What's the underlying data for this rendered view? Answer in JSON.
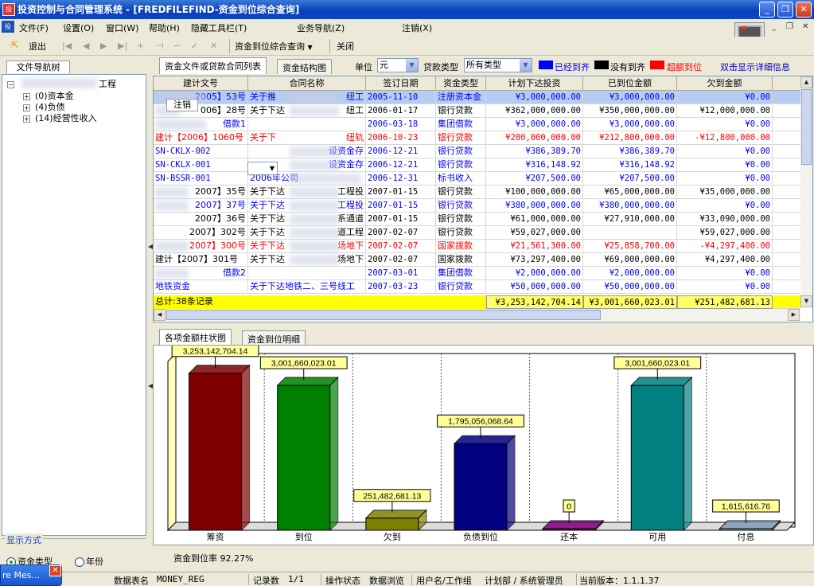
{
  "window": {
    "title": "投资控制与合同管理系统 - [FREDFILEFIND-资金到位综合查询]"
  },
  "menu": [
    "文件(F)",
    "设置(O)",
    "窗口(W)",
    "帮助(H)",
    "隐藏工具栏(T)",
    "业务导航(Z)",
    "注销(X)"
  ],
  "toolbar": {
    "exit": "退出",
    "query": "资金到位综合查询",
    "close": "关闭"
  },
  "left": {
    "tab": "文件导航树",
    "tab2": "",
    "tree": [
      {
        "label": "工程",
        "sign": "−"
      },
      {
        "label": "(0)资本金",
        "sign": "+"
      },
      {
        "label": "(4)负债",
        "sign": "+"
      },
      {
        "label": "(14)经营性收入",
        "sign": "+"
      }
    ],
    "display_title": "显示方式",
    "radio1": "资金类型",
    "radio2": "年份"
  },
  "top_tabs": [
    "资金文件或贷款合同列表",
    "资金结构图"
  ],
  "filters": {
    "unit_label": "单位",
    "unit_value": "元",
    "loan_label": "贷款类型",
    "loan_value": "所有类型"
  },
  "legend": [
    {
      "label": "已经到齐",
      "color": "#0000ff"
    },
    {
      "label": "没有到齐",
      "color": "#000000"
    },
    {
      "label": "超额到位",
      "color": "#ff0000"
    },
    {
      "label": "双击显示详细信息",
      "color": ""
    }
  ],
  "grid": {
    "columns": [
      "建计文号",
      "合同名称",
      "签订日期",
      "资金类型",
      "计划下达投资",
      "已到位金额",
      "欠到金额"
    ],
    "rows": [
      {
        "doc": "2005】53号",
        "name": "关于推",
        "name2": "纽工",
        "date": "2005-11-10",
        "type": "注册资本金",
        "plan": "¥3,000,000.00",
        "arrived": "¥3,000,000.00",
        "owed": "¥0.00",
        "status": "selected"
      },
      {
        "doc": "006】28号",
        "name": "关于下达",
        "name2": "纽工",
        "date": "2006-01-17",
        "type": "银行贷款",
        "plan": "¥362,000,000.00",
        "arrived": "¥350,000,000.00",
        "owed": "¥12,000,000.00",
        "status": "short"
      },
      {
        "doc": "借款1",
        "name": "",
        "name2": "",
        "date": "2006-03-18",
        "type": "集团借款",
        "plan": "¥3,000,000.00",
        "arrived": "¥3,000,000.00",
        "owed": "¥0.00",
        "status": "full"
      },
      {
        "doc": "建计【2006】1060号",
        "name": "关于下",
        "name2": "纽轨",
        "date": "2006-10-23",
        "type": "银行贷款",
        "plan": "¥200,000,000.00",
        "arrived": "¥212,800,000.00",
        "owed": "-¥12,800,000.00",
        "status": "over"
      },
      {
        "doc": "SN-CKLX-002",
        "name": "",
        "name2": "设资金存",
        "date": "2006-12-21",
        "type": "银行贷款",
        "plan": "¥386,389.70",
        "arrived": "¥386,389.70",
        "owed": "¥0.00",
        "status": "full"
      },
      {
        "doc": "SN-CKLX-001",
        "name": "",
        "name2": "设资金存",
        "date": "2006-12-21",
        "type": "银行贷款",
        "plan": "¥316,148.92",
        "arrived": "¥316,148.92",
        "owed": "¥0.00",
        "status": "full"
      },
      {
        "doc": "SN-BSSR-001",
        "name": "2006年公司",
        "name2": "",
        "date": "2006-12-31",
        "type": "标书收入",
        "plan": "¥207,500.00",
        "arrived": "¥207,500.00",
        "owed": "¥0.00",
        "status": "full"
      },
      {
        "doc": "2007】35号",
        "name": "关于下达",
        "name2": "工程投",
        "date": "2007-01-15",
        "type": "银行贷款",
        "plan": "¥100,000,000.00",
        "arrived": "¥65,000,000.00",
        "owed": "¥35,000,000.00",
        "status": "short"
      },
      {
        "doc": "2007】37号",
        "name": "关于下达",
        "name2": "工程投",
        "date": "2007-01-15",
        "type": "银行贷款",
        "plan": "¥380,000,000.00",
        "arrived": "¥380,000,000.00",
        "owed": "¥0.00",
        "status": "full"
      },
      {
        "doc": "2007】36号",
        "name": "关于下达",
        "name2": "系通道",
        "date": "2007-01-15",
        "type": "银行贷款",
        "plan": "¥61,000,000.00",
        "arrived": "¥27,910,000.00",
        "owed": "¥33,090,000.00",
        "status": "short"
      },
      {
        "doc": "2007】302号",
        "name": "关于下达",
        "name2": "道工程",
        "date": "2007-02-07",
        "type": "银行贷款",
        "plan": "¥59,027,000.00",
        "arrived": "",
        "owed": "¥59,027,000.00",
        "status": "short"
      },
      {
        "doc": "2007】300号",
        "name": "关于下达",
        "name2": "场地下",
        "date": "2007-02-07",
        "type": "国家拨款",
        "plan": "¥21,561,300.00",
        "arrived": "¥25,858,700.00",
        "owed": "-¥4,297,400.00",
        "status": "over"
      },
      {
        "doc": "建计【2007】301号",
        "name": "关于下达",
        "name2": "场地下",
        "date": "2007-02-07",
        "type": "国家拨款",
        "plan": "¥73,297,400.00",
        "arrived": "¥69,000,000.00",
        "owed": "¥4,297,400.00",
        "status": "short"
      },
      {
        "doc": "借款2",
        "name": "",
        "name2": "",
        "date": "2007-03-01",
        "type": "集团借款",
        "plan": "¥2,000,000.00",
        "arrived": "¥2,000,000.00",
        "owed": "¥0.00",
        "status": "full"
      },
      {
        "doc": "地铁资金",
        "name": "关于下达地铁二、三号线工",
        "name2": "",
        "date": "2007-03-23",
        "type": "银行贷款",
        "plan": "¥50,000,000.00",
        "arrived": "¥50,000,000.00",
        "owed": "¥0.00",
        "status": "full"
      }
    ],
    "popup_text": "注销",
    "summary": {
      "label": "总计:38条记录",
      "plan": "¥3,253,142,704.14",
      "arrived": "¥3,001,660,023.01",
      "owed": "¥251,482,681.13"
    }
  },
  "chart_tabs": [
    "各项金额柱状图",
    "资金到位明细"
  ],
  "chart_data": {
    "type": "bar",
    "categories": [
      "筹资",
      "到位",
      "欠到",
      "负债到位",
      "还本",
      "可用",
      "付息"
    ],
    "values": [
      3253142704.14,
      3001660023.01,
      251482681.13,
      1795056068.64,
      0,
      3001660023.01,
      1615616.76
    ],
    "labels": [
      "3,253,142,704.14",
      "3,001,660,023.01",
      "251,482,681.13",
      "1,795,056,068.64",
      "0",
      "3,001,660,023.01",
      "1,615,616.76"
    ],
    "colors": [
      "#800000",
      "#008000",
      "#808000",
      "#000080",
      "#800080",
      "#008080",
      "#7f9db9"
    ],
    "ylim": [
      0,
      3500000000
    ],
    "grid": true
  },
  "rate_text": "资金到位率 92.27%",
  "status": {
    "table_label": "数据表名",
    "table_value": "MONEY_REG",
    "count_label": "记录数",
    "count_value": "1/1",
    "op_label": "操作状态",
    "op_value": "数据浏览",
    "user_label": "用户名/工作组",
    "user_value": "计划部 / 系统管理员",
    "version": "当前版本：1.1.1.37"
  },
  "taskbar": {
    "label": "re Mes..."
  }
}
